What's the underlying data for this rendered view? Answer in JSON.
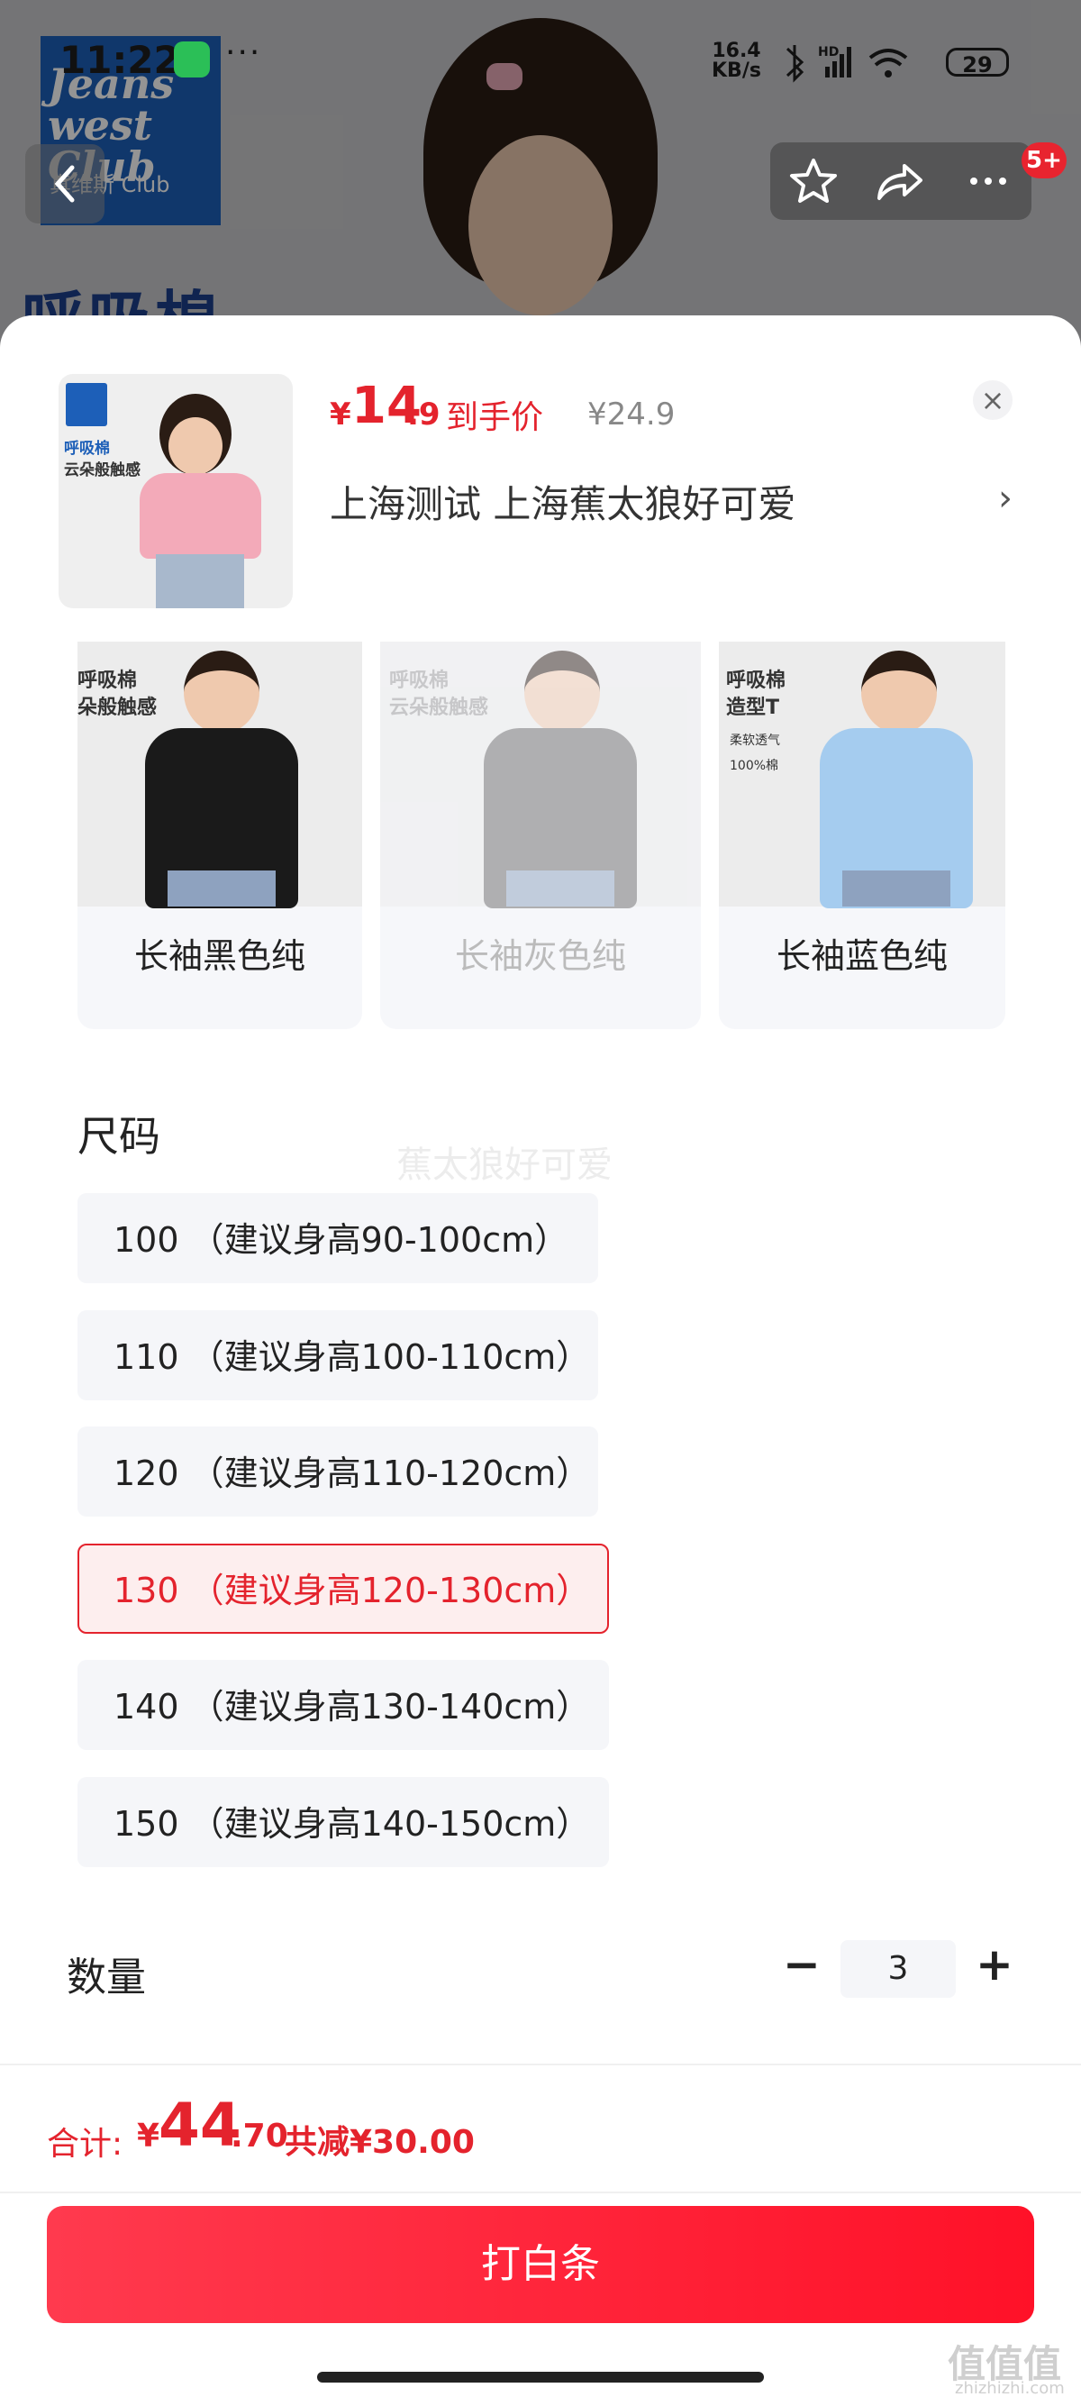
{
  "status_bar": {
    "time": "11:22",
    "dots": "···",
    "net_speed_value": "16.4",
    "net_speed_unit": "KB/s",
    "network": "HD",
    "battery": "29"
  },
  "background": {
    "logo_line1": "Jeans",
    "logo_line2": "west",
    "logo_line3": "Club",
    "logo_sub": "真维斯 Club",
    "title_fragment": "呼吸棉",
    "badge": "5+"
  },
  "sheet": {
    "product_thumb_text1": "呼吸棉",
    "product_thumb_text2": "云朵般触感",
    "price": {
      "currency": "¥",
      "integer": "14",
      "decimal": ".9",
      "tag": "到手价",
      "original": "¥24.9"
    },
    "close": "×",
    "address": "上海测试  上海蕉太狼好可爱",
    "address_arrow": "›",
    "colors": [
      {
        "label": "长袖黑色纯",
        "card_text1": "呼吸棉",
        "card_text2": "朵般触感",
        "enabled": true,
        "shirt_color": "#1a1a1a"
      },
      {
        "label": "长袖灰色纯",
        "card_text1": "呼吸棉",
        "card_text2": "云朵般触感",
        "enabled": false,
        "shirt_color": "#6a6a6a"
      },
      {
        "label": "长袖蓝色纯",
        "card_text1": "呼吸棉",
        "card_text2": "造型T",
        "badge1": "柔软透气",
        "badge2": "100%棉",
        "enabled": true,
        "shirt_color": "#a5ccef"
      }
    ],
    "size_title": "尺码",
    "watermark": "蕉太狼好可爱",
    "sizes": [
      {
        "label": "100 （建议身高90-100cm）",
        "selected": false
      },
      {
        "label": "110 （建议身高100-110cm）",
        "selected": false
      },
      {
        "label": "120 （建议身高110-120cm）",
        "selected": false
      },
      {
        "label": "130 （建议身高120-130cm）",
        "selected": true
      },
      {
        "label": "140 （建议身高130-140cm）",
        "selected": false
      },
      {
        "label": "150 （建议身高140-150cm）",
        "selected": false
      }
    ],
    "quantity_label": "数量",
    "quantity_minus": "−",
    "quantity_value": "3",
    "quantity_plus": "+"
  },
  "footer": {
    "total_label": "合计:",
    "total_currency": "¥",
    "total_integer": "44",
    "total_decimal": ".70",
    "saved": "共减¥30.00",
    "cta": "打白条",
    "corner_watermark": "值值值",
    "corner_watermark_sub": "zhizhizhi.com"
  },
  "colors": {
    "accent": "#e4232d",
    "cta_start": "#ff3a4e",
    "cta_end": "#ff1128"
  }
}
